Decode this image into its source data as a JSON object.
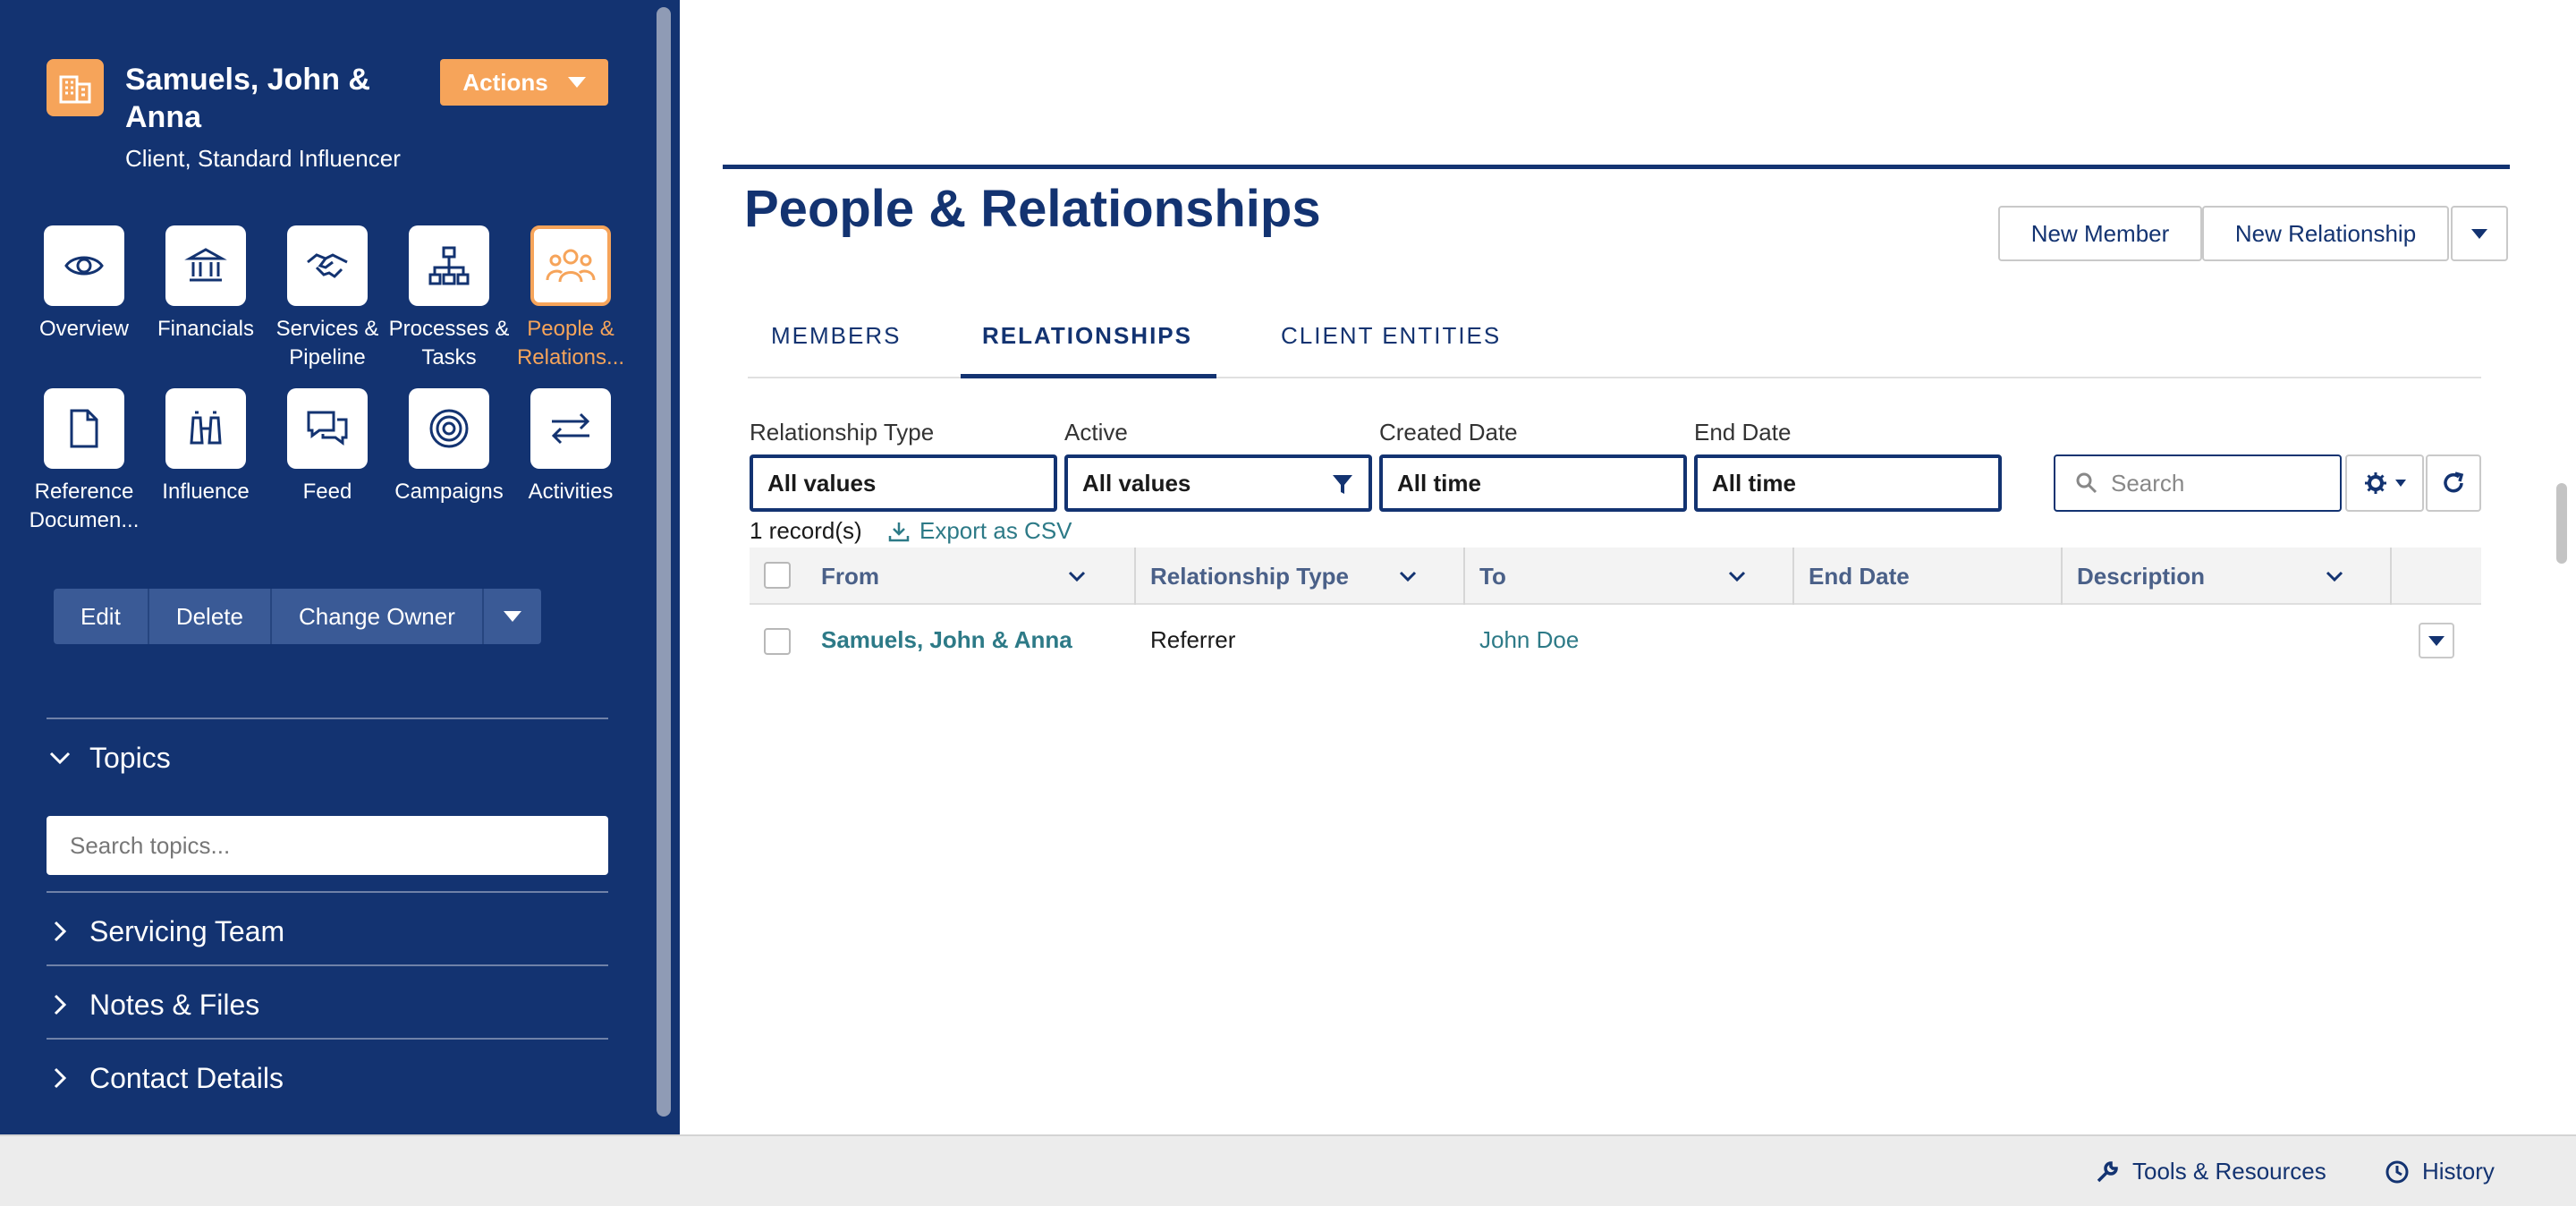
{
  "record": {
    "name": "Samuels, John & Anna",
    "subtitle": "Client, Standard Influencer",
    "actions_label": "Actions"
  },
  "nav": [
    {
      "label": "Overview",
      "icon": "eye-icon"
    },
    {
      "label": "Financials",
      "icon": "bank-icon"
    },
    {
      "label": "Services & Pipeline",
      "icon": "handshake-icon"
    },
    {
      "label": "Processes & Tasks",
      "icon": "org-chart-icon"
    },
    {
      "label": "People & Relations...",
      "icon": "people-icon",
      "active": true
    },
    {
      "label": "Reference Documen...",
      "icon": "document-icon"
    },
    {
      "label": "Influence",
      "icon": "binoculars-icon"
    },
    {
      "label": "Feed",
      "icon": "chat-bubbles-icon"
    },
    {
      "label": "Campaigns",
      "icon": "target-icon"
    },
    {
      "label": "Activities",
      "icon": "arrows-exchange-icon"
    }
  ],
  "record_buttons": {
    "edit": "Edit",
    "delete": "Delete",
    "change_owner": "Change Owner"
  },
  "sections": {
    "topics": "Topics",
    "topics_placeholder": "Search topics...",
    "servicing_team": "Servicing Team",
    "notes_files": "Notes & Files",
    "contact_details": "Contact Details"
  },
  "page": {
    "title": "People & Relationships",
    "new_member": "New Member",
    "new_relationship": "New Relationship"
  },
  "tabs": [
    {
      "label": "MEMBERS"
    },
    {
      "label": "RELATIONSHIPS",
      "active": true
    },
    {
      "label": "CLIENT ENTITIES"
    }
  ],
  "filters": [
    {
      "label": "Relationship Type",
      "value": "All values"
    },
    {
      "label": "Active",
      "value": "All values"
    },
    {
      "label": "Created Date",
      "value": "All time"
    },
    {
      "label": "End Date",
      "value": "All time"
    }
  ],
  "search_placeholder": "Search",
  "record_count": "1 record(s)",
  "export_label": "Export as CSV",
  "table": {
    "columns": [
      "From",
      "Relationship Type",
      "To",
      "End Date",
      "Description"
    ],
    "rows": [
      {
        "from": "Samuels, John & Anna",
        "type": "Referrer",
        "to": "John Doe",
        "end_date": "",
        "description": ""
      }
    ]
  },
  "footer": {
    "tools": "Tools & Resources",
    "history": "History"
  },
  "colors": {
    "navy": "#133371",
    "accent": "#f6a45a",
    "link": "#2d7a87"
  }
}
